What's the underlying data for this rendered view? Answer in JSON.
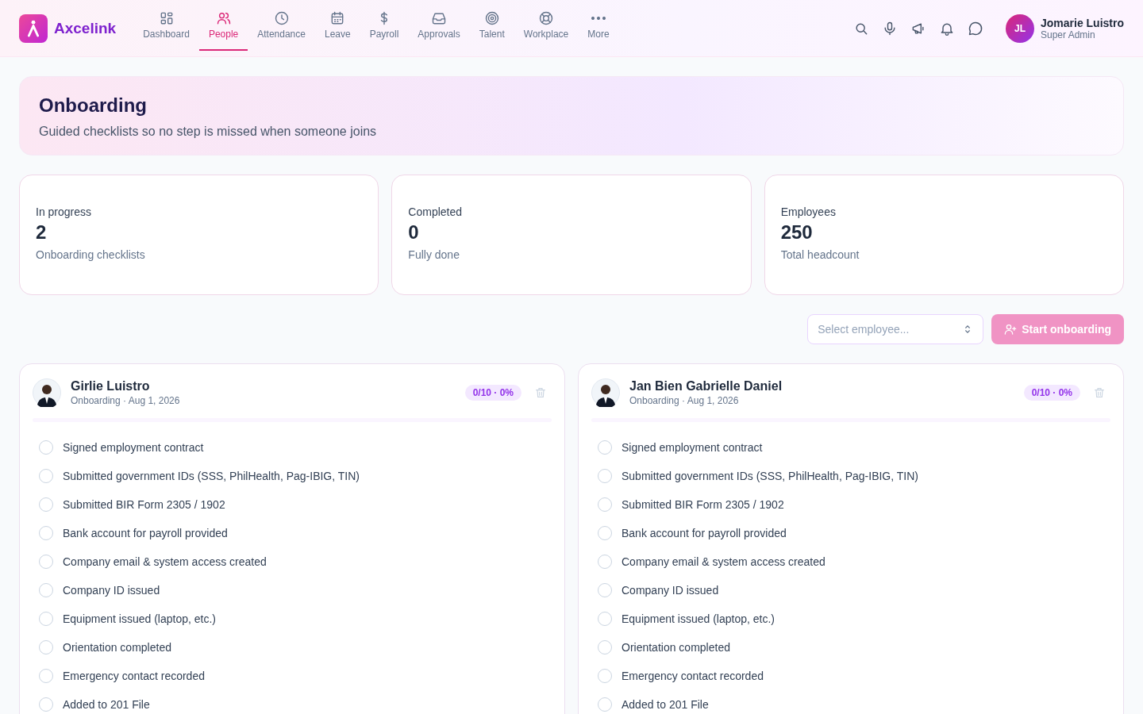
{
  "brand": {
    "name": "Axcelink"
  },
  "nav": [
    {
      "label": "Dashboard",
      "selected": false
    },
    {
      "label": "People",
      "selected": true
    },
    {
      "label": "Attendance",
      "selected": false
    },
    {
      "label": "Leave",
      "selected": false
    },
    {
      "label": "Payroll",
      "selected": false
    },
    {
      "label": "Approvals",
      "selected": false
    },
    {
      "label": "Talent",
      "selected": false
    },
    {
      "label": "Workplace",
      "selected": false
    },
    {
      "label": "More",
      "selected": false
    }
  ],
  "user": {
    "initials": "JL",
    "name": "Jomarie Luistro",
    "role": "Super Admin"
  },
  "hero": {
    "title": "Onboarding",
    "subtitle": "Guided checklists so no step is missed when someone joins"
  },
  "stats": [
    {
      "label": "In progress",
      "value": "2",
      "caption": "Onboarding checklists"
    },
    {
      "label": "Completed",
      "value": "0",
      "caption": "Fully done"
    },
    {
      "label": "Employees",
      "value": "250",
      "caption": "Total headcount"
    }
  ],
  "employee_select": {
    "placeholder": "Select employee..."
  },
  "start_button": {
    "label": "Start onboarding",
    "disabled": true
  },
  "checklists": [
    {
      "name": "Girlie Luistro",
      "meta": "Onboarding · Aug 1, 2026",
      "badge": "0/10 · 0%",
      "level": 0,
      "tasks": [
        {
          "label": "Signed employment contract",
          "checked": false
        },
        {
          "label": "Submitted government IDs (SSS, PhilHealth, Pag-IBIG, TIN)",
          "checked": false
        },
        {
          "label": "Submitted BIR Form 2305 / 1902",
          "checked": false
        },
        {
          "label": "Bank account for payroll provided",
          "checked": false
        },
        {
          "label": "Company email & system access created",
          "checked": false
        },
        {
          "label": "Company ID issued",
          "checked": false
        },
        {
          "label": "Equipment issued (laptop, etc.)",
          "checked": false
        },
        {
          "label": "Orientation completed",
          "checked": false
        },
        {
          "label": "Emergency contact recorded",
          "checked": false
        },
        {
          "label": "Added to 201 File",
          "checked": false
        }
      ]
    },
    {
      "name": "Jan Bien Gabrielle Daniel",
      "meta": "Onboarding · Aug 1, 2026",
      "badge": "0/10 · 0%",
      "level": 0,
      "tasks": [
        {
          "label": "Signed employment contract",
          "checked": false
        },
        {
          "label": "Submitted government IDs (SSS, PhilHealth, Pag-IBIG, TIN)",
          "checked": false
        },
        {
          "label": "Submitted BIR Form 2305 / 1902",
          "checked": false
        },
        {
          "label": "Bank account for payroll provided",
          "checked": false
        },
        {
          "label": "Company email & system access created",
          "checked": false
        },
        {
          "label": "Company ID issued",
          "checked": false
        },
        {
          "label": "Equipment issued (laptop, etc.)",
          "checked": false
        },
        {
          "label": "Orientation completed",
          "checked": false
        },
        {
          "label": "Emergency contact recorded",
          "checked": false
        },
        {
          "label": "Added to 201 File",
          "checked": false
        }
      ]
    }
  ]
}
